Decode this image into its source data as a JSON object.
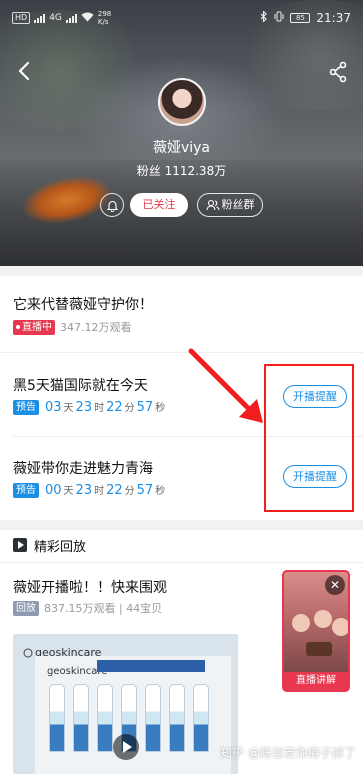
{
  "status_bar": {
    "network": "HD",
    "signal_label": "4G",
    "speed_value": "298",
    "speed_unit": "K/s",
    "battery": "85",
    "time": "21:37"
  },
  "profile": {
    "nickname": "薇娅viya",
    "fans": "粉丝 1112.38万",
    "follow_label": "已关注",
    "fan_group_label": "粉丝群"
  },
  "live_items": [
    {
      "title": "它来代替薇娅守护你！",
      "badge": "直播中",
      "viewers": "347.12万观看"
    },
    {
      "title": "黑5天猫国际就在今天",
      "badge": "预告",
      "countdown": {
        "d": "03",
        "d_unit": "天",
        "h": "23",
        "h_unit": "时",
        "m": "22",
        "m_unit": "分",
        "s": "57",
        "s_unit": "秒"
      },
      "button": "开播提醒"
    },
    {
      "title": "薇娅带你走进魅力青海",
      "badge": "预告",
      "countdown": {
        "d": "00",
        "d_unit": "天",
        "h": "23",
        "h_unit": "时",
        "m": "22",
        "m_unit": "分",
        "s": "57",
        "s_unit": "秒"
      },
      "button": "开播提醒"
    }
  ],
  "replay_section": {
    "title": "精彩回放",
    "item": {
      "title": "薇娅开播啦！！快来围观",
      "badge": "回放",
      "meta": "837.15万观看 | 44宝贝"
    },
    "thumb_brand": "geoskincare",
    "thumb_brand_inner": "geoskincare"
  },
  "floating_live": {
    "label": "直播讲解"
  },
  "watermark": "知乎 @陈信宏你瘠子掉了",
  "colors": {
    "accent_red": "#e8384f",
    "accent_blue": "#1b8fe3",
    "annotation_red": "#f01e1e"
  }
}
